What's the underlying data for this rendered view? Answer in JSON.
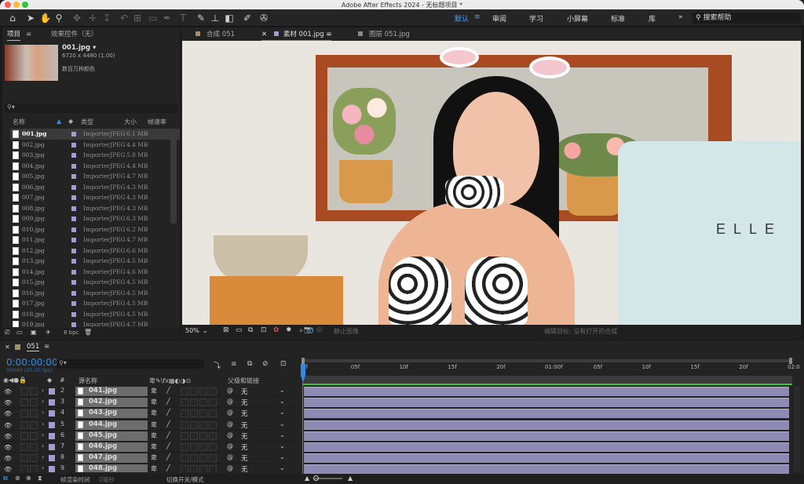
{
  "app": {
    "title": "Adobe After Effects 2024 - 无标题项目 *"
  },
  "workspaces": {
    "items": [
      "默认",
      "审阅",
      "学习",
      "小屏幕",
      "标准",
      "库"
    ],
    "search_placeholder": "搜索帮助"
  },
  "project_panel": {
    "tab_project": "项目",
    "tab_effects": "效果控件（无）",
    "selected": {
      "name": "001.jpg ▾",
      "dims": "6720 x 4480 (1.00)",
      "colors": "数百万种颜色"
    },
    "columns": {
      "name": "名称",
      "type": "类型",
      "size": "大小",
      "rate": "帧速率"
    },
    "files": [
      {
        "name": "001.jpg",
        "type": "ImporterJPEG",
        "size": "6.1 MB"
      },
      {
        "name": "002.jpg",
        "type": "ImporterJPEG",
        "size": "4.4 MB"
      },
      {
        "name": "003.jpg",
        "type": "ImporterJPEG",
        "size": "5.8 MB"
      },
      {
        "name": "004.jpg",
        "type": "ImporterJPEG",
        "size": "4.4 MB"
      },
      {
        "name": "005.jpg",
        "type": "ImporterJPEG",
        "size": "4.7 MB"
      },
      {
        "name": "006.jpg",
        "type": "ImporterJPEG",
        "size": "4.3 MB"
      },
      {
        "name": "007.jpg",
        "type": "ImporterJPEG",
        "size": "4.3 MB"
      },
      {
        "name": "008.jpg",
        "type": "ImporterJPEG",
        "size": "4.3 MB"
      },
      {
        "name": "009.jpg",
        "type": "ImporterJPEG",
        "size": "6.3 MB"
      },
      {
        "name": "010.jpg",
        "type": "ImporterJPEG",
        "size": "6.2 MB"
      },
      {
        "name": "011.jpg",
        "type": "ImporterJPEG",
        "size": "4.7 MB"
      },
      {
        "name": "012.jpg",
        "type": "ImporterJPEG",
        "size": "6.6 MB"
      },
      {
        "name": "013.jpg",
        "type": "ImporterJPEG",
        "size": "4.5 MB"
      },
      {
        "name": "014.jpg",
        "type": "ImporterJPEG",
        "size": "4.6 MB"
      },
      {
        "name": "015.jpg",
        "type": "ImporterJPEG",
        "size": "4.5 MB"
      },
      {
        "name": "016.jpg",
        "type": "ImporterJPEG",
        "size": "4.5 MB"
      },
      {
        "name": "017.jpg",
        "type": "ImporterJPEG",
        "size": "4.5 MB"
      },
      {
        "name": "018.jpg",
        "type": "ImporterJPEG",
        "size": "4.5 MB"
      },
      {
        "name": "019.jpg",
        "type": "ImporterJPEG",
        "size": "4.7 MB"
      }
    ],
    "bpc": "8 bpc"
  },
  "viewer": {
    "tabs": [
      "合成 051",
      "素材 001.jpg",
      "图层 051.jpg"
    ],
    "zoom": "50%",
    "exposure": "+0.0",
    "status_left": "静止图像",
    "status_right": "编辑目标: 没有打开的合成",
    "scene_text": "ELLE"
  },
  "timeline": {
    "comp_tab": "051",
    "timecode": "0:00:00:00",
    "fps": "00000 (25.00 fps)",
    "col_source": "源名称",
    "col_parent": "父级和链接",
    "ruler": [
      "0f",
      "05f",
      "10f",
      "15f",
      "20f",
      "01:00f",
      "05f",
      "10f",
      "15f",
      "20f",
      "02:0"
    ],
    "layers": [
      {
        "num": "2",
        "name": "041.jpg",
        "parent": "无"
      },
      {
        "num": "3",
        "name": "042.jpg",
        "parent": "无"
      },
      {
        "num": "4",
        "name": "043.jpg",
        "parent": "无"
      },
      {
        "num": "5",
        "name": "044.jpg",
        "parent": "无"
      },
      {
        "num": "6",
        "name": "045.jpg",
        "parent": "无"
      },
      {
        "num": "7",
        "name": "046.jpg",
        "parent": "无"
      },
      {
        "num": "8",
        "name": "047.jpg",
        "parent": "无"
      },
      {
        "num": "9",
        "name": "048.jpg",
        "parent": "无"
      }
    ],
    "render_time_label": "帧渲染时间",
    "render_time": "0毫秒",
    "toggle_label": "切换开关/模式"
  },
  "colors": {
    "accent": "#2d8ceb",
    "label_lavender": "#a49bd3",
    "layer_bar": "#8d8bb3",
    "workarea": "#3ac23a"
  }
}
